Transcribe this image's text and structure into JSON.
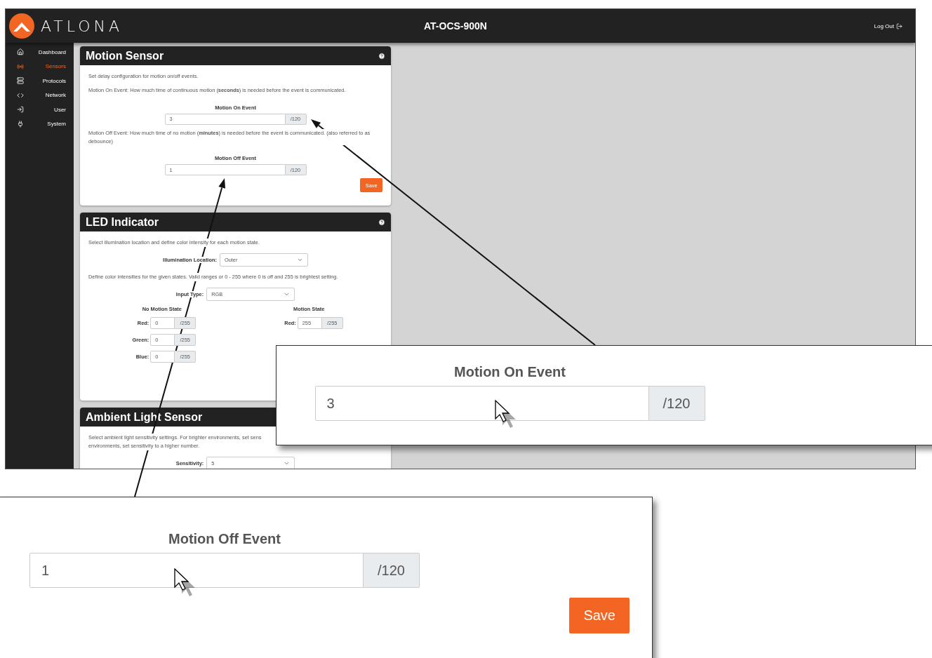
{
  "header": {
    "wordmark": "ATLONA",
    "title": "AT-OCS-900N",
    "logout": "Log Out"
  },
  "sidebar": [
    {
      "label": "Dashboard",
      "selected": false
    },
    {
      "label": "Sensors",
      "selected": true
    },
    {
      "label": "Protocols",
      "selected": false
    },
    {
      "label": "Network",
      "selected": false
    },
    {
      "label": "User",
      "selected": false
    },
    {
      "label": "System",
      "selected": false
    }
  ],
  "motion_sensor": {
    "title": "Motion Sensor",
    "intro": "Set delay configuration for motion on/off events.",
    "on_help": "Motion On Event: How much time of continuous motion (**seconds**) is needed before the event is communicated.",
    "on_field": {
      "label": "Motion On Event",
      "value": "3",
      "unit": "/120"
    },
    "off_help": "Motion Off Event: How much time of no motion (**minutes**) is needed before the event is communicated. (also referred to as debounce)",
    "off_field": {
      "label": "Motion Off Event",
      "value": "1",
      "unit": "/120"
    },
    "save": "Save"
  },
  "led_indicator": {
    "title": "LED Indicator",
    "intro": "Select illumination location and define color intensity for each motion state.",
    "location": {
      "label": "Illumination Location:",
      "value": "Outer"
    },
    "ranges_help": "Define color intensities for the given states. Valid ranges or 0 - 255 where 0 is off and 255 is brightest setting.",
    "input_type": {
      "label": "Input Type:",
      "value": "RGB"
    },
    "states": [
      {
        "title": "No Motion State",
        "channels": [
          {
            "label": "Red:",
            "value": "0",
            "unit": "/255"
          },
          {
            "label": "Green:",
            "value": "0",
            "unit": "/255"
          },
          {
            "label": "Blue:",
            "value": "0",
            "unit": "/255"
          }
        ]
      },
      {
        "title": "Motion State",
        "channels": [
          {
            "label": "Red:",
            "value": "255",
            "unit": "/255"
          }
        ]
      }
    ]
  },
  "ambient_light_sensor": {
    "title": "Ambient Light Sensor",
    "intro_lines": [
      "Select ambient light sensitivity settings. For brighter environments, set sens",
      "environments, set sensitivity to a higher number."
    ],
    "sensitivity": {
      "label": "Sensitivity:",
      "value": "5"
    }
  },
  "callouts": [
    {
      "label": "Motion On Event",
      "value": "3",
      "unit": "/120"
    },
    {
      "label": "Motion Off Event",
      "value": "1",
      "unit": "/120",
      "button": "Save"
    }
  ]
}
